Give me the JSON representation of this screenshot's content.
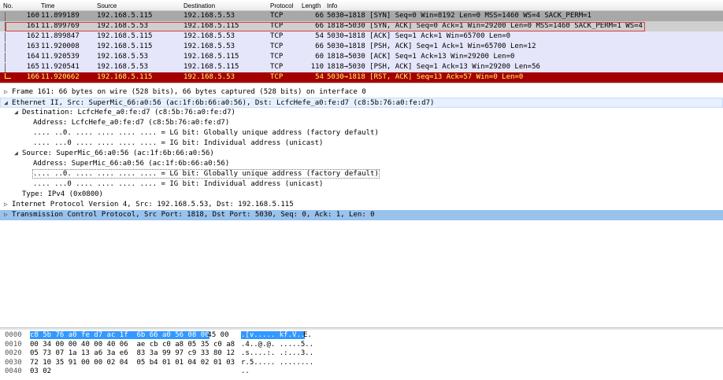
{
  "columns": {
    "no": "No.",
    "time": "Time",
    "source": "Source",
    "destination": "Destination",
    "protocol": "Protocol",
    "length": "Length",
    "info": "Info"
  },
  "packets": [
    {
      "no": "160",
      "time": "11.899189",
      "src": "192.168.5.115",
      "dst": "192.168.5.53",
      "proto": "TCP",
      "len": "66",
      "info": "5030→1818 [SYN] Seq=0 Win=8192 Len=0 MSS=1460 WS=4 SACK_PERM=1"
    },
    {
      "no": "161",
      "time": "11.899769",
      "src": "192.168.5.53",
      "dst": "192.168.5.115",
      "proto": "TCP",
      "len": "66",
      "info": "1818→5030 [SYN, ACK] Seq=0 Ack=1 Win=29200 Len=0 MSS=1460 SACK_PERM=1 WS=4"
    },
    {
      "no": "162",
      "time": "11.899847",
      "src": "192.168.5.115",
      "dst": "192.168.5.53",
      "proto": "TCP",
      "len": "54",
      "info": "5030→1818 [ACK] Seq=1 Ack=1 Win=65700 Len=0"
    },
    {
      "no": "163",
      "time": "11.920008",
      "src": "192.168.5.115",
      "dst": "192.168.5.53",
      "proto": "TCP",
      "len": "66",
      "info": "5030→1818 [PSH, ACK] Seq=1 Ack=1 Win=65700 Len=12"
    },
    {
      "no": "164",
      "time": "11.920539",
      "src": "192.168.5.53",
      "dst": "192.168.5.115",
      "proto": "TCP",
      "len": "60",
      "info": "1818→5030 [ACK] Seq=1 Ack=13 Win=29200 Len=0"
    },
    {
      "no": "165",
      "time": "11.920541",
      "src": "192.168.5.53",
      "dst": "192.168.5.115",
      "proto": "TCP",
      "len": "110",
      "info": "1818→5030 [PSH, ACK] Seq=1 Ack=13 Win=29200 Len=56"
    },
    {
      "no": "166",
      "time": "11.920662",
      "src": "192.168.5.115",
      "dst": "192.168.5.53",
      "proto": "TCP",
      "len": "54",
      "info": "5030→1818 [RST, ACK] Seq=13 Ack=57 Win=0 Len=0"
    }
  ],
  "details": [
    {
      "arrow": "▷",
      "indent": 0,
      "text": "Frame 161: 66 bytes on wire (528 bits), 66 bytes captured (528 bits) on interface 0"
    },
    {
      "arrow": "◢",
      "indent": 0,
      "text": "Ethernet II, Src: SuperMic_66:a0:56 (ac:1f:6b:66:a0:56), Dst: LcfcHefe_a0:fe:d7 (c8:5b:76:a0:fe:d7)"
    },
    {
      "arrow": "◢",
      "indent": 1,
      "text": "Destination: LcfcHefe_a0:fe:d7 (c8:5b:76:a0:fe:d7)"
    },
    {
      "arrow": "",
      "indent": 2,
      "text": "Address: LcfcHefe_a0:fe:d7 (c8:5b:76:a0:fe:d7)"
    },
    {
      "arrow": "",
      "indent": 2,
      "text": ".... ..0. .... .... .... .... = LG bit: Globally unique address (factory default)"
    },
    {
      "arrow": "",
      "indent": 2,
      "text": ".... ...0 .... .... .... .... = IG bit: Individual address (unicast)"
    },
    {
      "arrow": "◢",
      "indent": 1,
      "text": "Source: SuperMic_66:a0:56 (ac:1f:6b:66:a0:56)"
    },
    {
      "arrow": "",
      "indent": 2,
      "text": "Address: SuperMic_66:a0:56 (ac:1f:6b:66:a0:56)"
    },
    {
      "arrow": "",
      "indent": 2,
      "text": ".... ..0. .... .... .... .... = LG bit: Globally unique address (factory default)"
    },
    {
      "arrow": "",
      "indent": 2,
      "text": ".... ...0 .... .... .... .... = IG bit: Individual address (unicast)"
    },
    {
      "arrow": "",
      "indent": 1,
      "text": "Type: IPv4 (0x0800)"
    },
    {
      "arrow": "▷",
      "indent": 0,
      "text": "Internet Protocol Version 4, Src: 192.168.5.53, Dst: 192.168.5.115"
    },
    {
      "arrow": "▷",
      "indent": 0,
      "text": "Transmission Control Protocol, Src Port: 1818, Dst Port: 5030, Seq: 0, Ack: 1, Len: 0"
    }
  ],
  "bytes": [
    {
      "offset": "0000",
      "hex_sel": "c8 5b 76 a0 fe d7 ac 1f  6b 66 a0 56 08 00",
      "hex_rest": " 45 00",
      "ascii_sel": ".[v..... kf.V..",
      "ascii_rest": "E."
    },
    {
      "offset": "0010",
      "hex_sel": "",
      "hex_rest": "00 34 00 00 40 00 40 06  ae cb c0 a8 05 35 c0 a8",
      "ascii_sel": "",
      "ascii_rest": ".4..@.@. .....5.."
    },
    {
      "offset": "0020",
      "hex_sel": "",
      "hex_rest": "05 73 07 1a 13 a6 3a e6  83 3a 99 97 c9 33 80 12",
      "ascii_sel": "",
      "ascii_rest": ".s....:. .:...3.."
    },
    {
      "offset": "0030",
      "hex_sel": "",
      "hex_rest": "72 10 35 91 00 00 02 04  05 b4 01 01 04 02 01 03",
      "ascii_sel": "",
      "ascii_rest": "r.5..... ........"
    },
    {
      "offset": "0040",
      "hex_sel": "",
      "hex_rest": "03 02",
      "ascii_sel": "",
      "ascii_rest": ".."
    }
  ]
}
